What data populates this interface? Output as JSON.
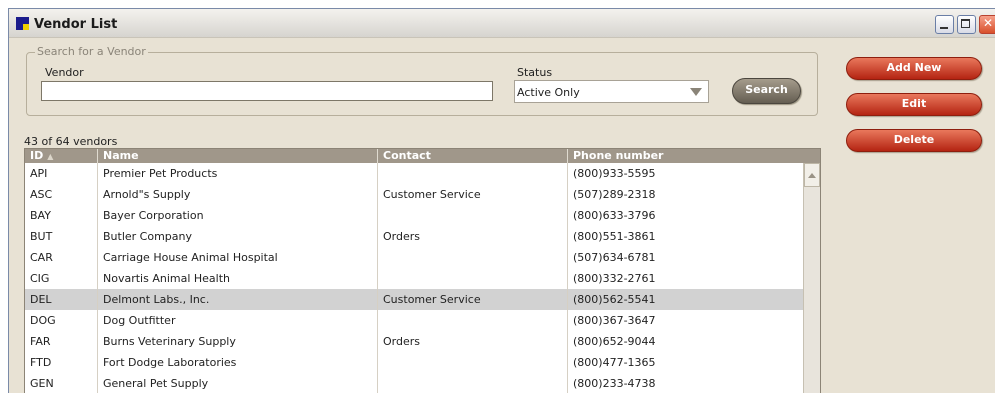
{
  "window": {
    "title": "Vendor List"
  },
  "search": {
    "legend": "Search for a Vendor",
    "vendor_label": "Vendor",
    "vendor_value": "",
    "status_label": "Status",
    "status_value": "Active Only",
    "search_button": "Search"
  },
  "actions": {
    "add_new": "Add New",
    "edit": "Edit",
    "delete": "Delete"
  },
  "list": {
    "count_text": "43 of 64 vendors",
    "columns": [
      "ID",
      "Name",
      "Contact",
      "Phone number"
    ],
    "sort_column": "ID",
    "sort_direction": "ascending",
    "selected_row": 6,
    "rows": [
      {
        "id": "API",
        "name": "Premier Pet Products",
        "contact": "",
        "phone": "(800)933-5595"
      },
      {
        "id": "ASC",
        "name": "Arnold\"s Supply",
        "contact": "Customer Service",
        "phone": "(507)289-2318"
      },
      {
        "id": "BAY",
        "name": "Bayer Corporation",
        "contact": "",
        "phone": "(800)633-3796"
      },
      {
        "id": "BUT",
        "name": "Butler Company",
        "contact": "Orders",
        "phone": "(800)551-3861"
      },
      {
        "id": "CAR",
        "name": "Carriage House Animal Hospital",
        "contact": "",
        "phone": "(507)634-6781"
      },
      {
        "id": "CIG",
        "name": "Novartis Animal Health",
        "contact": "",
        "phone": "(800)332-2761"
      },
      {
        "id": "DEL",
        "name": "Delmont Labs., Inc.",
        "contact": "Customer Service",
        "phone": "(800)562-5541"
      },
      {
        "id": "DOG",
        "name": "Dog Outfitter",
        "contact": "",
        "phone": "(800)367-3647"
      },
      {
        "id": "FAR",
        "name": "Burns Veterinary Supply",
        "contact": "Orders",
        "phone": "(800)652-9044"
      },
      {
        "id": "FTD",
        "name": "Fort Dodge Laboratories",
        "contact": "",
        "phone": "(800)477-1365"
      },
      {
        "id": "GEN",
        "name": "General Pet Supply",
        "contact": "",
        "phone": "(800)233-4738"
      }
    ]
  },
  "colors": {
    "button_red": "#c8341a",
    "header_bg": "#a0978a",
    "panel_bg": "#e8e2d4",
    "selected_row": "#d2d2d2"
  }
}
